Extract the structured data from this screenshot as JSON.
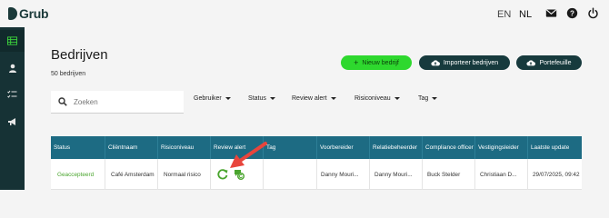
{
  "brand": {
    "name": "Grub"
  },
  "topbar": {
    "lang_en": "EN",
    "lang_nl": "NL",
    "icons": [
      "mail-icon",
      "help-icon",
      "power-icon"
    ]
  },
  "sidebar": {
    "items": [
      "companies-icon",
      "user-icon",
      "checklist-icon",
      "megaphone-icon"
    ]
  },
  "page": {
    "title": "Bedrijven",
    "count": "50 bedrijven"
  },
  "actions": {
    "new_label": "Nieuw bedrijf",
    "import_label": "Importeer bedrijven",
    "portfolio_label": "Portefeuille"
  },
  "search": {
    "placeholder": "Zoeken"
  },
  "filters": {
    "user": "Gebruiker",
    "status": "Status",
    "review_alert": "Review alert",
    "risk_level": "Risiconiveau",
    "tag": "Tag"
  },
  "table": {
    "headers": [
      "Status",
      "Cliëntnaam",
      "Risiconiveau",
      "Review alert",
      "Tag",
      "Voorbereider",
      "Relatiebeheerder",
      "Compliance officer",
      "Vestigingsleider",
      "Laatste update"
    ],
    "rows": [
      {
        "status": "Geaccepteerd",
        "client": "Café Amsterdam",
        "risk": "Normaal risico",
        "tag": "",
        "preparer": "Danny Mouri...",
        "relation": "Danny Mouri...",
        "compliance": "Buck Stelder",
        "branch": "Christiaan D...",
        "updated": "29/07/2025, 09:42"
      }
    ]
  },
  "colors": {
    "sidebar": "#163235",
    "table_header": "#1d6b83",
    "primary_button": "#2ed82e",
    "dark_button": "#173a3d",
    "status_accepted": "#4aa52e",
    "annotation_arrow": "#e8453c"
  }
}
